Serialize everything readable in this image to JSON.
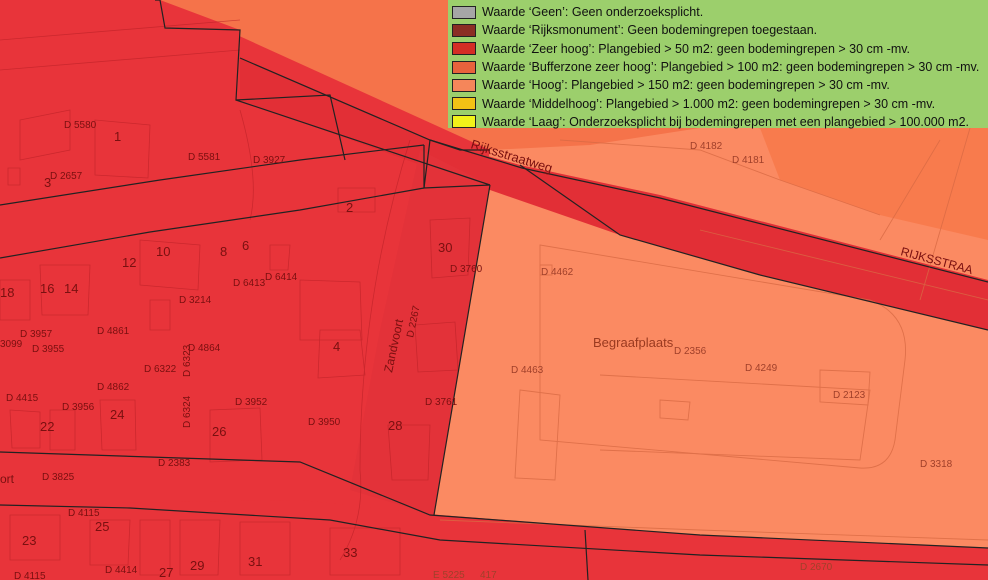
{
  "legend": {
    "items": [
      {
        "color": "#a6a6a6",
        "text": "Waarde ‘Geen’: Geen onderzoeksplicht."
      },
      {
        "color": "#8b2e24",
        "text": "Waarde ‘Rijksmonument’: Geen bodemingrepen toegestaan."
      },
      {
        "color": "#d42e25",
        "text": "Waarde ‘Zeer hoog’: Plangebied > 50 m2: geen bodemingrepen > 30 cm -mv."
      },
      {
        "color": "#e8623c",
        "text": "Waarde ‘Bufferzone zeer hoog’: Plangebied > 100 m2: geen bodemingrepen > 30 cm -mv."
      },
      {
        "color": "#f5865a",
        "text": "Waarde ‘Hoog’: Plangebied > 150 m2: geen bodemingrepen > 30 cm -mv."
      },
      {
        "color": "#f2c215",
        "text": "Waarde ‘Middelhoog’: Plangebied > 1.000 m2: geen bodemingrepen > 30 cm -mv."
      },
      {
        "color": "#f2f21a",
        "text": "Waarde ‘Laag’: Onderzoeksplicht bij bodemingrepen met een plangebied > 100.000 m2."
      }
    ]
  },
  "colors": {
    "zeer_hoog_zone": "#e8343a",
    "buffer_zone": "#f0683c",
    "hoog_zone": "#fb8a62",
    "outline": "#222222",
    "label": "#7a1010"
  },
  "map": {
    "street_labels": {
      "rijksstraatweg_1": "Rijksstraatweg",
      "rijksstraatweg_2": "RIJKSSTRAA",
      "zandvoort": "Zandvoort",
      "ort": "ort"
    },
    "area_label": "Begraafplaats",
    "house_numbers": {
      "n1": "1",
      "n2": "2",
      "n3": "3",
      "n4": "4",
      "n6": "6",
      "n8": "8",
      "n10": "10",
      "n12": "12",
      "n14": "14",
      "n16": "16",
      "n18": "18",
      "n22": "22",
      "n23": "23",
      "n24": "24",
      "n25": "25",
      "n26": "26",
      "n27": "27",
      "n28": "28",
      "n29": "29",
      "n30": "30",
      "n31": "31",
      "n33": "33"
    },
    "parcels": {
      "p5580": "D 5580",
      "p5581": "D 5581",
      "p3927": "D 3927",
      "p2657": "D 2657",
      "p4182": "D 4182",
      "p4181": "D 4181",
      "p4462": "D 4462",
      "p3760": "D 3760",
      "p2267": "D 2267",
      "p6413": "D 6413",
      "p6414": "D 6414",
      "p3214": "D 3214",
      "p3957": "D 3957",
      "p4861": "D 4861",
      "p3955": "D 3955",
      "p3099": "3099",
      "p6323": "D 6323",
      "p4864": "D 4864",
      "p6322": "D 6322",
      "p4862": "D 4862",
      "p4415": "D 4415",
      "p3956": "D 3956",
      "p6324": "D 6324",
      "p3952": "D 3952",
      "p3950": "D 3950",
      "p3761": "D 3761",
      "p2356": "D 2356",
      "p4463": "D 4463",
      "p4249": "D 4249",
      "p2123": "D 2123",
      "p3318": "D 3318",
      "p2383": "D 2383",
      "p3825": "D 3825",
      "p4115": "D 4115",
      "p4115b": "D 4115",
      "p4414": "D 4414",
      "p2670": "D 2670",
      "pE5225": "E 5225",
      "p417": "417"
    }
  }
}
